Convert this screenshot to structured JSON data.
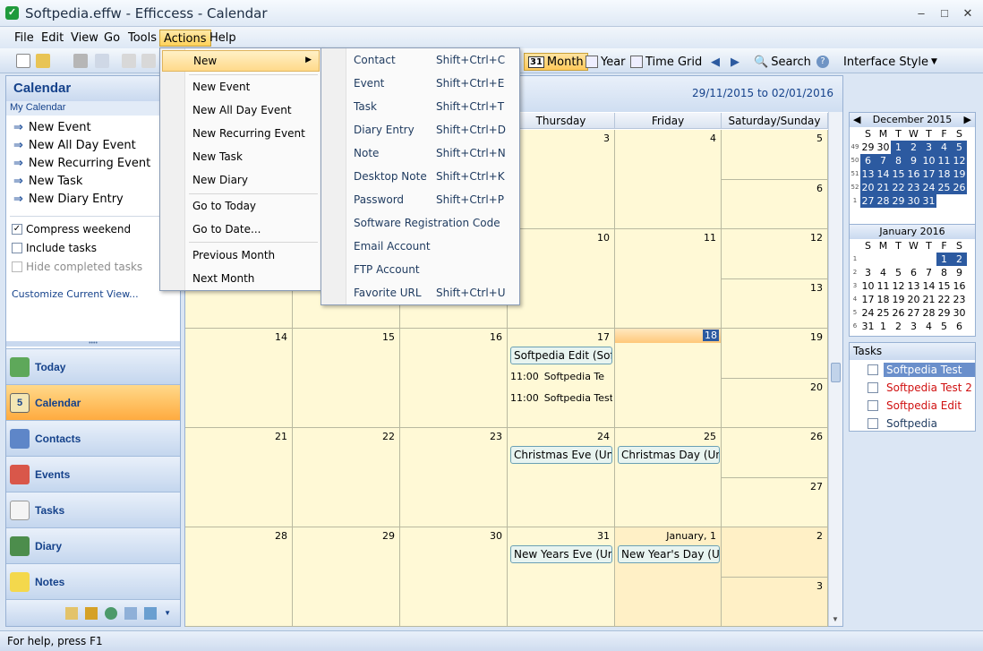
{
  "window": {
    "title": "Softpedia.effw - Efficcess - Calendar",
    "min": "–",
    "max": "□",
    "close": "✕"
  },
  "menubar": [
    "File",
    "Edit",
    "View",
    "Go",
    "Tools",
    "Actions",
    "Help"
  ],
  "toolbar": {
    "month": "Month",
    "month_icon": "31",
    "year": "Year",
    "timegrid": "Time Grid",
    "search": "Search",
    "interface_style": "Interface Style"
  },
  "left": {
    "header": "Calendar",
    "sub": "My Calendar",
    "links": [
      "New Event",
      "New All Day Event",
      "New Recurring Event",
      "New Task",
      "New Diary Entry"
    ],
    "checks": [
      {
        "label": "Compress weekend",
        "checked": true
      },
      {
        "label": "Include tasks",
        "checked": false
      },
      {
        "label": "Hide completed tasks",
        "checked": false
      }
    ],
    "customize": "Customize Current View...",
    "nav": [
      "Today",
      "Calendar",
      "Contacts",
      "Events",
      "Tasks",
      "Diary",
      "Notes"
    ]
  },
  "cal": {
    "range": "29/11/2015 to 02/01/2016",
    "headers": [
      "Thursday",
      "Friday",
      "Saturday/Sunday"
    ],
    "rows": [
      {
        "nums": [
          "",
          "",
          "",
          "3",
          "4",
          "5",
          "6"
        ]
      },
      {
        "nums": [
          "",
          "",
          "",
          "10",
          "11",
          "12",
          "13"
        ]
      },
      {
        "nums": [
          "14",
          "15",
          "16",
          "17",
          "18",
          "19",
          "20"
        ]
      },
      {
        "nums": [
          "21",
          "22",
          "23",
          "24",
          "25",
          "26",
          "27"
        ]
      },
      {
        "nums": [
          "28",
          "29",
          "30",
          "31",
          "January, 1",
          "2",
          "3"
        ]
      }
    ],
    "events": {
      "e17a": "Softpedia Edit (Softpe",
      "e17b_time": "11:00",
      "e17b": "Softpedia Te",
      "e17c_time": "11:00",
      "e17c": "Softpedia Test (S",
      "e24": "Christmas Eve (United",
      "e25": "Christmas Day (United",
      "e31": "New Years Eve (Unitec",
      "e1": "New Year's Day (Unite"
    }
  },
  "minical1": {
    "title": "December 2015",
    "days": [
      "S",
      "M",
      "T",
      "W",
      "T",
      "F",
      "S"
    ],
    "weeks": [
      {
        "wk": "49",
        "d": [
          "29",
          "30",
          "1",
          "2",
          "3",
          "4",
          "5"
        ]
      },
      {
        "wk": "50",
        "d": [
          "6",
          "7",
          "8",
          "9",
          "10",
          "11",
          "12"
        ]
      },
      {
        "wk": "51",
        "d": [
          "13",
          "14",
          "15",
          "16",
          "17",
          "18",
          "19"
        ]
      },
      {
        "wk": "52",
        "d": [
          "20",
          "21",
          "22",
          "23",
          "24",
          "25",
          "26"
        ]
      },
      {
        "wk": "1",
        "d": [
          "27",
          "28",
          "29",
          "30",
          "31",
          "",
          ""
        ]
      }
    ]
  },
  "minical2": {
    "title": "January 2016",
    "days": [
      "S",
      "M",
      "T",
      "W",
      "T",
      "F",
      "S"
    ],
    "weeks": [
      {
        "wk": "1",
        "d": [
          "",
          "",
          "",
          "",
          "",
          "1",
          "2"
        ]
      },
      {
        "wk": "2",
        "d": [
          "3",
          "4",
          "5",
          "6",
          "7",
          "8",
          "9"
        ]
      },
      {
        "wk": "3",
        "d": [
          "10",
          "11",
          "12",
          "13",
          "14",
          "15",
          "16"
        ]
      },
      {
        "wk": "4",
        "d": [
          "17",
          "18",
          "19",
          "20",
          "21",
          "22",
          "23"
        ]
      },
      {
        "wk": "5",
        "d": [
          "24",
          "25",
          "26",
          "27",
          "28",
          "29",
          "30"
        ]
      },
      {
        "wk": "6",
        "d": [
          "31",
          "1",
          "2",
          "3",
          "4",
          "5",
          "6"
        ]
      }
    ]
  },
  "tasks": {
    "header": "Tasks",
    "items": [
      {
        "label": "Softpedia Test",
        "color": "#ffffff",
        "bg": "#6a8fcb"
      },
      {
        "label": "Softpedia Test 2",
        "color": "#d01010",
        "bg": "#ffffff"
      },
      {
        "label": "Softpedia Edit",
        "color": "#d01010",
        "bg": "#ffffff"
      },
      {
        "label": "Softpedia",
        "color": "#1e3a5f",
        "bg": "#ffffff"
      }
    ]
  },
  "status": "For help, press F1",
  "actions_menu": [
    "New",
    "New Event",
    "New All Day Event",
    "New Recurring Event",
    "New Task",
    "New Diary",
    "Go to Today",
    "Go to Date...",
    "Previous Month",
    "Next Month"
  ],
  "new_menu": [
    {
      "label": "Contact",
      "sc": "Shift+Ctrl+C"
    },
    {
      "label": "Event",
      "sc": "Shift+Ctrl+E"
    },
    {
      "label": "Task",
      "sc": "Shift+Ctrl+T"
    },
    {
      "label": "Diary Entry",
      "sc": "Shift+Ctrl+D"
    },
    {
      "label": "Note",
      "sc": "Shift+Ctrl+N"
    },
    {
      "label": "Desktop Note",
      "sc": "Shift+Ctrl+K"
    },
    {
      "label": "Password",
      "sc": "Shift+Ctrl+P"
    },
    {
      "label": "Software Registration Code",
      "sc": ""
    },
    {
      "label": "Email Account",
      "sc": ""
    },
    {
      "label": "FTP Account",
      "sc": ""
    },
    {
      "label": "Favorite URL",
      "sc": "Shift+Ctrl+U"
    }
  ]
}
